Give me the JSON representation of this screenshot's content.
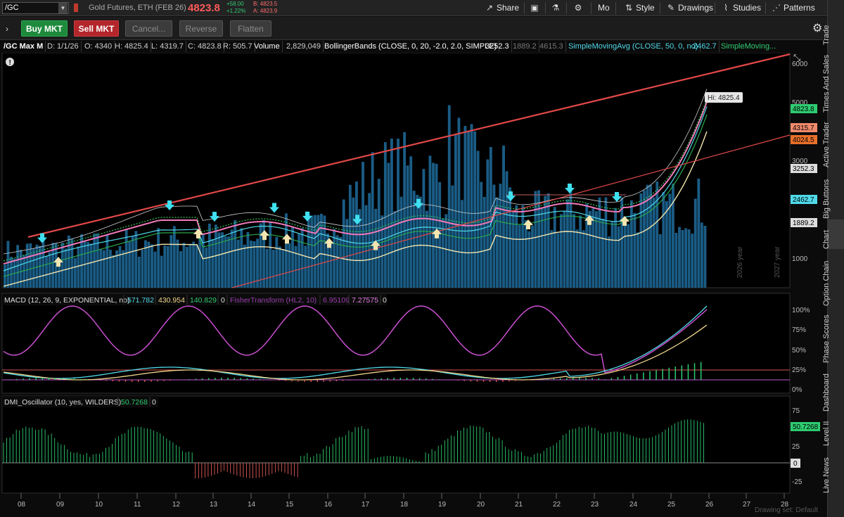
{
  "toolbar": {
    "symbol": "/GC",
    "description": "Gold Futures, ETH (FEB 26)",
    "last_price": "4823.8",
    "net_change": "+58.00",
    "pct_change": "+1.22%",
    "bid": "B: 4823.5",
    "ask": "A: 4823.9",
    "share": "Share",
    "mo": "Mo",
    "style": "Style",
    "drawings": "Drawings",
    "studies": "Studies",
    "patterns": "Patterns"
  },
  "orderbar": {
    "buy": "Buy MKT",
    "sell": "Sell MKT",
    "cancel": "Cancel...",
    "reverse": "Reverse",
    "flatten": "Flatten"
  },
  "studyhdr": {
    "sym": "/GC Max M",
    "date": "D: 1/1/26",
    "open": "O: 4340",
    "high": "H: 4825.4",
    "low": "L: 4319.7",
    "close": "C: 4823.8",
    "range": "R: 505.7",
    "vol_label": "Volume",
    "vol_value": "2,829,049",
    "bb_label": "BollingerBands (CLOSE, 0, 20, -2.0, 2.0, SIMPLE)",
    "bb_v1": "3252.3",
    "bb_v2": "1889.2",
    "bb_v3": "4615.3",
    "sma_label": "SimpleMovingAvg (CLOSE, 50, 0, no)",
    "sma_value": "2462.7",
    "sma2_label": "SimpleMoving..."
  },
  "price_panel": {
    "hi_label": "Hi: 4825.4",
    "axis": [
      "6000",
      "5000",
      "4000",
      "3000",
      "2000",
      "1000"
    ],
    "badges": [
      "4823.8",
      "4315.7",
      "4024.5",
      "3252.3",
      "2462.7",
      "1889.2"
    ],
    "badge_colors": [
      "#2ecc71",
      "#f08a6b",
      "#e8702a",
      "#dddddd",
      "#4fd9e8",
      "#dddddd"
    ],
    "year_labels": [
      "2026 year",
      "2027 year"
    ]
  },
  "macd_panel": {
    "label": "MACD (12, 26, 9, EXPONENTIAL, no)",
    "v1": "571.782",
    "v2": "430.954",
    "v3": "140.829",
    "v4": "0",
    "fisher_label": "FisherTransform (HL2, 10)",
    "f1": "6.95109",
    "f2": "7.27575",
    "f3": "0",
    "axis": [
      "100%",
      "75%",
      "50%",
      "25%",
      "0%"
    ]
  },
  "dmi_panel": {
    "label": "DMI_Oscillator (10, yes, WILDERS)",
    "value": "50.7268",
    "zero": "0",
    "axis": [
      "75",
      "50",
      "25",
      "0",
      "-25"
    ],
    "badge": "50.7268",
    "badge_zero": "0"
  },
  "xaxis": {
    "labels": [
      "08",
      "09",
      "10",
      "11",
      "12",
      "13",
      "14",
      "15",
      "16",
      "17",
      "18",
      "19",
      "20",
      "21",
      "22",
      "23",
      "24",
      "25",
      "26",
      "27",
      "28"
    ],
    "drawing_set": "Drawing set: Default"
  },
  "sidebar": [
    "Trade",
    "Times And Sales",
    "Active Trader",
    "Big Buttons",
    "Chart",
    "Option Chain",
    "Phase Scores",
    "Dashboard",
    "Level II",
    "Live News"
  ]
}
